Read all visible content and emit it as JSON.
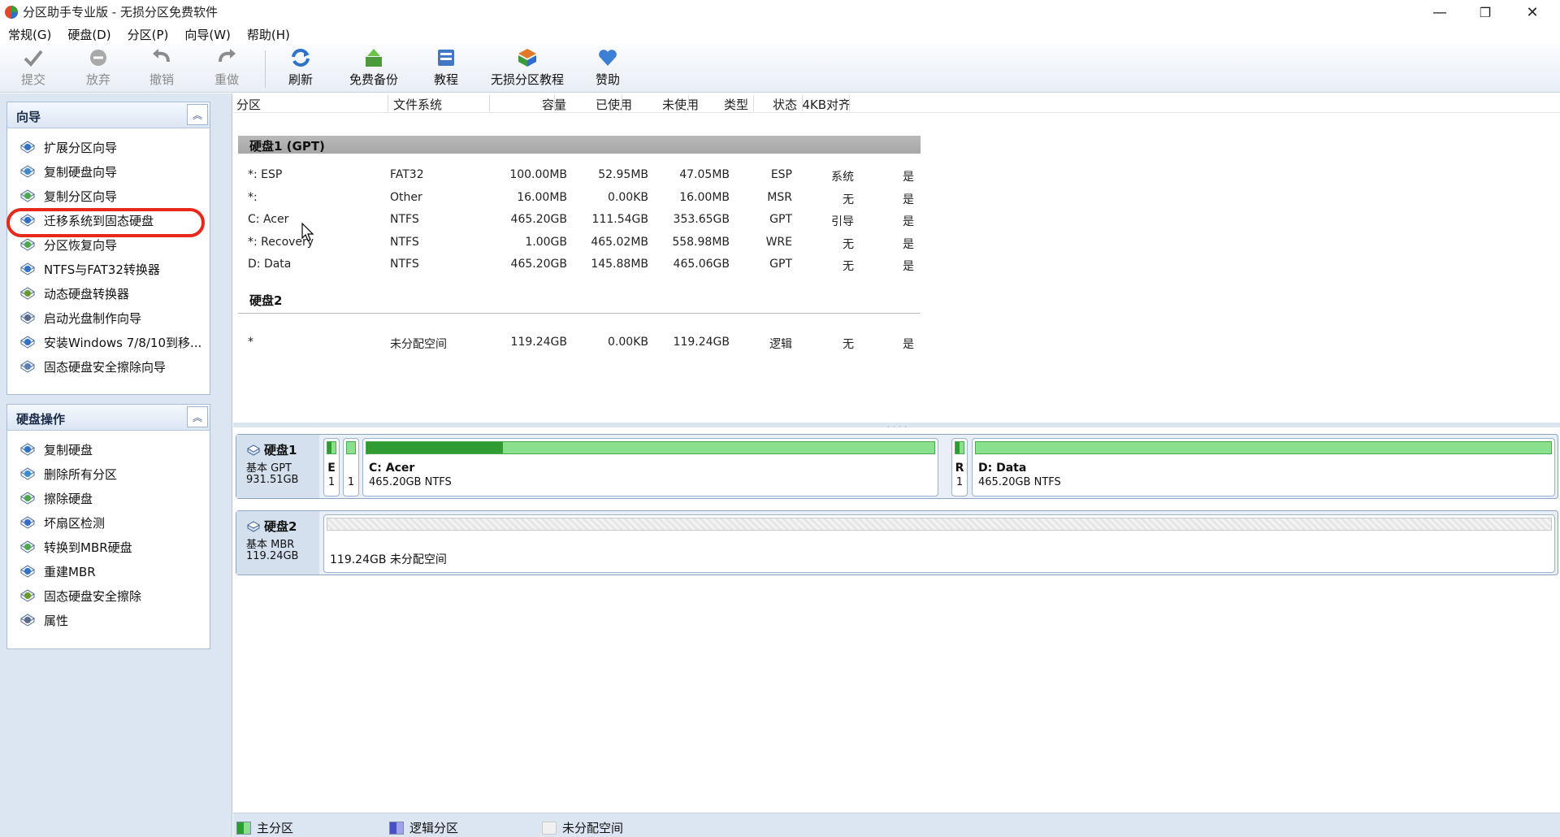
{
  "window": {
    "title": "分区助手专业版 - 无损分区免费软件",
    "minimize": "—",
    "maximize": "❐",
    "close": "✕"
  },
  "menu": [
    "常规(G)",
    "硬盘(D)",
    "分区(P)",
    "向导(W)",
    "帮助(H)"
  ],
  "toolbar": {
    "commit": "提交",
    "discard": "放弃",
    "undo": "撤销",
    "redo": "重做",
    "refresh": "刷新",
    "backup": "免费备份",
    "tutorial": "教程",
    "partition_tutorial": "无损分区教程",
    "donate": "赞助"
  },
  "wizard_panel": {
    "title": "向导",
    "items": [
      {
        "label": "扩展分区向导",
        "icon": "extend-partition-icon"
      },
      {
        "label": "复制硬盘向导",
        "icon": "copy-disk-icon"
      },
      {
        "label": "复制分区向导",
        "icon": "copy-partition-icon"
      },
      {
        "label": "迁移系统到固态硬盘",
        "icon": "migrate-os-icon"
      },
      {
        "label": "分区恢复向导",
        "icon": "partition-recovery-icon"
      },
      {
        "label": "NTFS与FAT32转换器",
        "icon": "ntfs-fat32-icon"
      },
      {
        "label": "动态硬盘转换器",
        "icon": "dynamic-disk-icon"
      },
      {
        "label": "启动光盘制作向导",
        "icon": "bootable-media-icon"
      },
      {
        "label": "安装Windows 7/8/10到移...",
        "icon": "windows-to-go-icon"
      },
      {
        "label": "固态硬盘安全擦除向导",
        "icon": "ssd-erase-wizard-icon"
      }
    ]
  },
  "disk_ops_panel": {
    "title": "硬盘操作",
    "items": [
      {
        "label": "复制硬盘",
        "icon": "copy-disk-icon"
      },
      {
        "label": "删除所有分区",
        "icon": "delete-partitions-icon"
      },
      {
        "label": "擦除硬盘",
        "icon": "wipe-disk-icon"
      },
      {
        "label": "坏扇区检测",
        "icon": "bad-sector-icon"
      },
      {
        "label": "转换到MBR硬盘",
        "icon": "convert-mbr-icon"
      },
      {
        "label": "重建MBR",
        "icon": "rebuild-mbr-icon"
      },
      {
        "label": "固态硬盘安全擦除",
        "icon": "ssd-erase-icon"
      },
      {
        "label": "属性",
        "icon": "properties-icon"
      }
    ]
  },
  "table": {
    "headers": [
      "分区",
      "文件系统",
      "容量",
      "已使用",
      "未使用",
      "类型",
      "状态",
      "4KB对齐"
    ],
    "disk1_label": "硬盘1 (GPT)",
    "disk2_label": "硬盘2",
    "disk1_rows": [
      [
        "*: ESP",
        "FAT32",
        "100.00MB",
        "52.95MB",
        "47.05MB",
        "ESP",
        "系统",
        "是"
      ],
      [
        "*:",
        "Other",
        "16.00MB",
        "0.00KB",
        "16.00MB",
        "MSR",
        "无",
        "是"
      ],
      [
        "C: Acer",
        "NTFS",
        "465.20GB",
        "111.54GB",
        "353.65GB",
        "GPT",
        "引导",
        "是"
      ],
      [
        "*: Recovery",
        "NTFS",
        "1.00GB",
        "465.02MB",
        "558.98MB",
        "WRE",
        "无",
        "是"
      ],
      [
        "D: Data",
        "NTFS",
        "465.20GB",
        "145.88MB",
        "465.06GB",
        "GPT",
        "无",
        "是"
      ]
    ],
    "disk2_rows": [
      [
        "*",
        "未分配空间",
        "119.24GB",
        "0.00KB",
        "119.24GB",
        "逻辑",
        "无",
        "是"
      ]
    ]
  },
  "disk_map": {
    "disk1": {
      "name": "硬盘1",
      "type": "基本 GPT",
      "size": "931.51GB",
      "partitions": [
        {
          "name": "E",
          "detail": "1",
          "used_fraction": 0.53
        },
        {
          "name": "",
          "detail": "1",
          "used_fraction": 0.0
        },
        {
          "name": "C: Acer",
          "detail": "465.20GB NTFS",
          "used_fraction": 0.24
        },
        {
          "name": "R",
          "detail": "1",
          "used_fraction": 0.45
        },
        {
          "name": "D: Data",
          "detail": "465.20GB NTFS",
          "used_fraction": 0.0
        }
      ]
    },
    "disk2": {
      "name": "硬盘2",
      "type": "基本 MBR",
      "size": "119.24GB",
      "unallocated": "119.24GB 未分配空间"
    }
  },
  "legend": {
    "primary": "主分区",
    "logical": "逻辑分区",
    "unallocated": "未分配空间"
  },
  "colors": {
    "primary": "#2e9b33",
    "primary_light": "#8be08d",
    "logical": "#4b4fc4",
    "highlight": "#e8281b"
  }
}
